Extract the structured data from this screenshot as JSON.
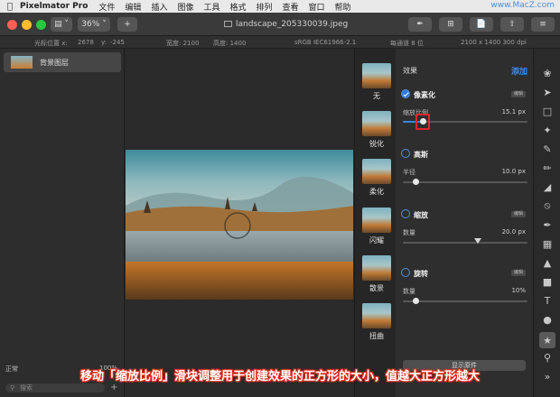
{
  "menubar": {
    "app_name": "Pixelmator Pro",
    "items": [
      "文件",
      "编辑",
      "插入",
      "图像",
      "工具",
      "格式",
      "排列",
      "查看",
      "窗口",
      "帮助"
    ],
    "watermark": "www.MacZ.com"
  },
  "toolbar": {
    "zoom": "36%",
    "document_title": "landscape_205330039.jpeg"
  },
  "infobar": {
    "cursor_label": "光标位置 x:",
    "cursor_x": "2678",
    "cursor_y_label": "y:",
    "cursor_y": "-245",
    "width": "宽度: 2100",
    "height": "高度: 1400",
    "color_profile": "sRGB IEC61966-2.1",
    "bit_depth": "每通道 8 位",
    "dimensions": "2100 x 1400 300 dpi"
  },
  "layers": {
    "layer_name": "背景图层",
    "blend_mode": "正常",
    "opacity": "100%",
    "search_placeholder": "搜索"
  },
  "effect_thumbs": [
    {
      "label": "无"
    },
    {
      "label": "锐化"
    },
    {
      "label": "柔化"
    },
    {
      "label": "闪耀"
    },
    {
      "label": "散景"
    },
    {
      "label": "扭曲"
    }
  ],
  "effects": {
    "title": "效果",
    "add_label": "添加",
    "show_original": "显示原件",
    "edit_label": "编辑",
    "pixelate": {
      "name": "像素化",
      "param": "缩放比例",
      "value": "15.1 px",
      "level": 0.16
    },
    "gaussian": {
      "name": "高斯",
      "param": "半径",
      "value": "10.0 px",
      "level": 0.1
    },
    "zoom": {
      "name": "缩放",
      "param": "数量",
      "value": "20.0 px",
      "level": 0.6
    },
    "spin": {
      "name": "旋转",
      "param": "数量",
      "value": "10%",
      "level": 0.1
    }
  },
  "caption": "移动「缩放比例」滑块调整用于创建效果的正方形的大小，值越大正方形越大"
}
